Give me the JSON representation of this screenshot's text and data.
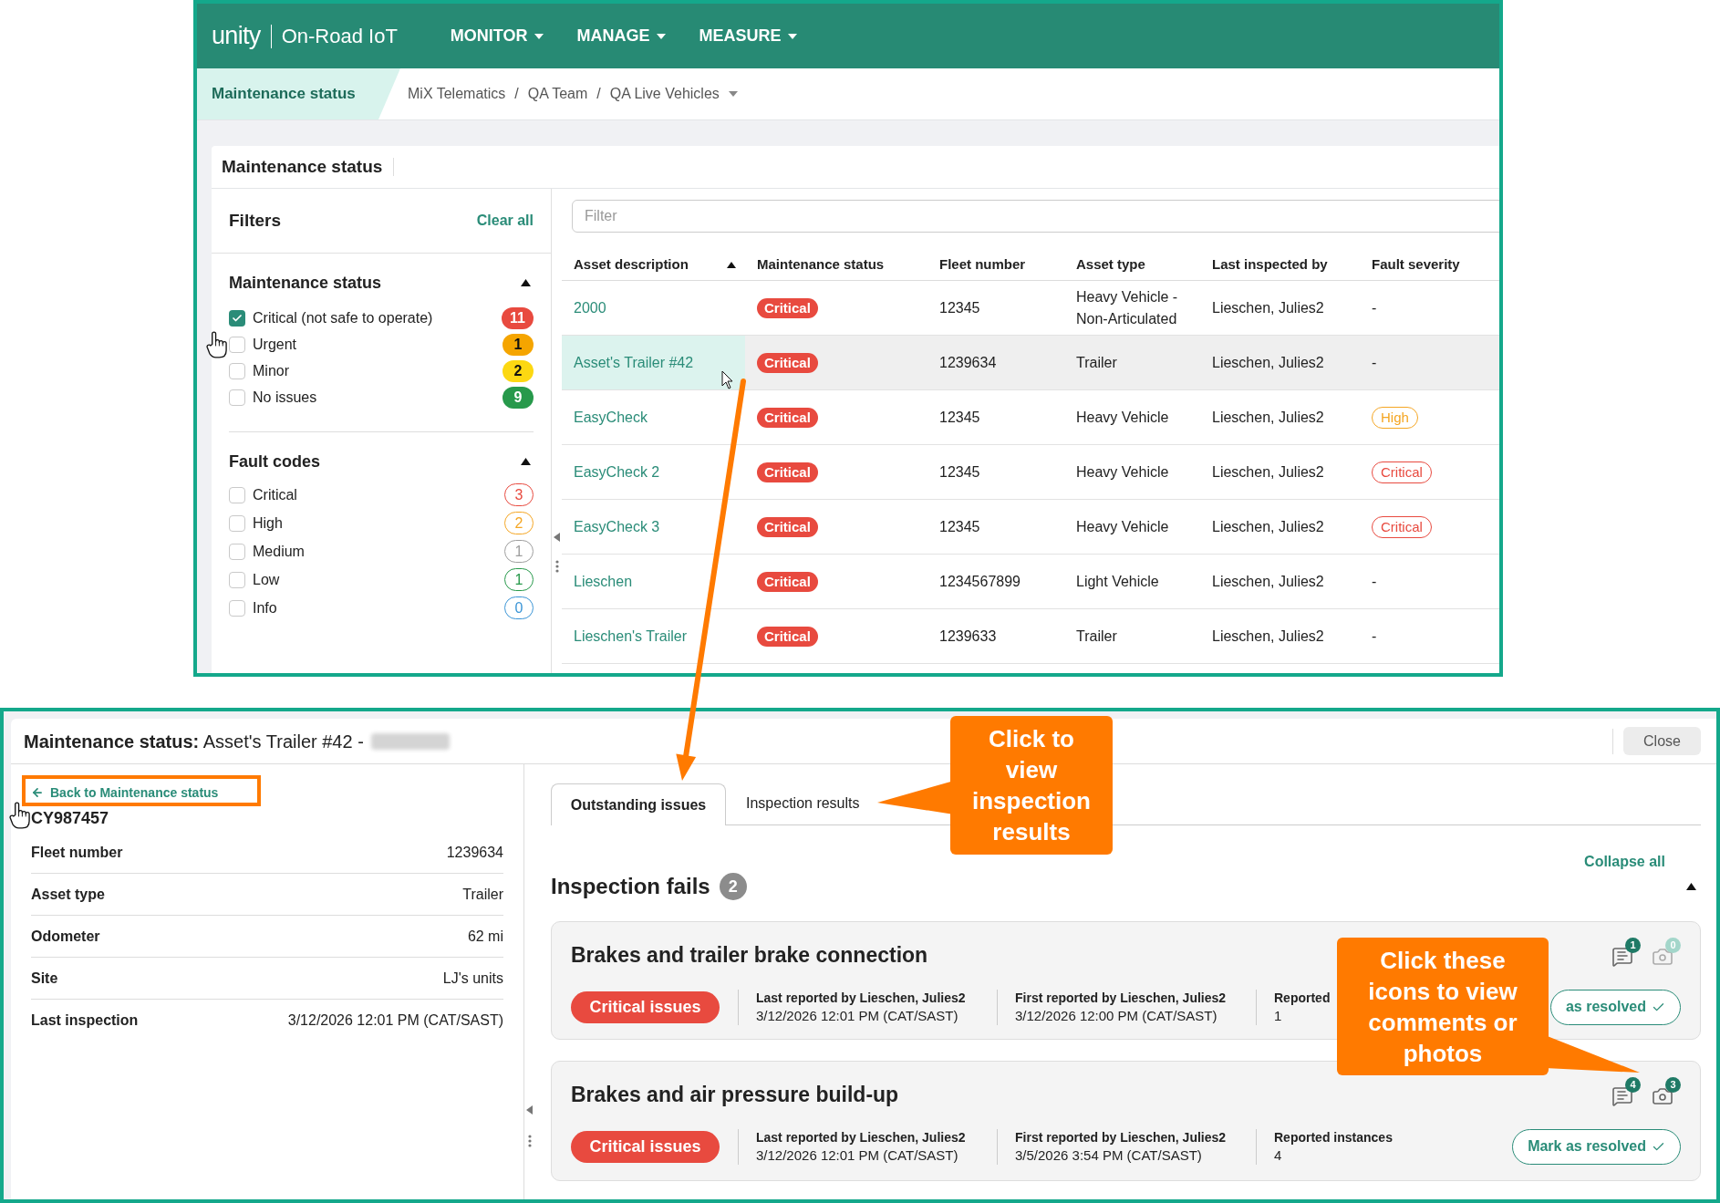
{
  "top_screenshot": {
    "brand": {
      "logo": "unity",
      "product": "On-Road IoT"
    },
    "nav_menu": [
      {
        "label": "MONITOR"
      },
      {
        "label": "MANAGE"
      },
      {
        "label": "MEASURE"
      }
    ],
    "breadcrumb": {
      "page": "Maintenance status",
      "path": [
        {
          "kind": "crumb",
          "label": "MiX Telematics"
        },
        {
          "kind": "separator",
          "label": "/"
        },
        {
          "kind": "crumb",
          "label": "QA Team"
        },
        {
          "kind": "separator",
          "label": "/"
        },
        {
          "kind": "dropdown",
          "label": "QA Live Vehicles"
        }
      ]
    },
    "card_title": "Maintenance status",
    "filters": {
      "title": "Filters",
      "clear_all": "Clear all",
      "sections": [
        {
          "title": "Maintenance status",
          "expanded": true,
          "options": [
            {
              "kind": "solid",
              "label": "Critical (not safe to operate)",
              "checked": true,
              "count": "11",
              "color": "#e84a3f"
            },
            {
              "kind": "solid",
              "label": "Urgent",
              "checked": false,
              "count": "1",
              "color": "#f5a500"
            },
            {
              "kind": "solid",
              "label": "Minor",
              "checked": false,
              "count": "2",
              "color": "#fcd812"
            },
            {
              "kind": "solid",
              "label": "No issues",
              "checked": false,
              "count": "9",
              "color": "#27994b"
            }
          ]
        },
        {
          "title": "Fault codes",
          "expanded": true,
          "options": [
            {
              "kind": "outline",
              "label": "Critical",
              "checked": false,
              "count": "3",
              "color": "#e84a3f"
            },
            {
              "kind": "outline",
              "label": "High",
              "checked": false,
              "count": "2",
              "color": "#f5a623"
            },
            {
              "kind": "outline",
              "label": "Medium",
              "checked": false,
              "count": "1",
              "color": "#9e9e9e"
            },
            {
              "kind": "outline",
              "label": "Low",
              "checked": false,
              "count": "1",
              "color": "#27994b"
            },
            {
              "kind": "outline",
              "label": "Info",
              "checked": false,
              "count": "0",
              "color": "#3b95d6"
            }
          ]
        }
      ]
    },
    "table": {
      "filter_placeholder": "Filter",
      "columns": [
        {
          "label": "Asset description",
          "sorted": true
        },
        {
          "label": "Maintenance status",
          "sorted": false
        },
        {
          "label": "Fleet number",
          "sorted": false
        },
        {
          "label": "Asset type",
          "sorted": false
        },
        {
          "label": "Last inspected by",
          "sorted": false
        },
        {
          "label": "Fault severity",
          "sorted": false
        }
      ],
      "rows": [
        {
          "highlighted": false,
          "asset": "2000",
          "status": "Critical",
          "fleet_number": "12345",
          "asset_type": "Heavy Vehicle - Non-Articulated",
          "inspected_by": "Lieschen, Julies2",
          "severity": {
            "kind": "text",
            "label": "-"
          }
        },
        {
          "highlighted": true,
          "asset": "Asset's Trailer #42",
          "status": "Critical",
          "fleet_number": "1239634",
          "asset_type": "Trailer",
          "inspected_by": "Lieschen, Julies2",
          "severity": {
            "kind": "text",
            "label": "-"
          }
        },
        {
          "highlighted": false,
          "asset": "EasyCheck",
          "status": "Critical",
          "fleet_number": "12345",
          "asset_type": "Heavy Vehicle",
          "inspected_by": "Lieschen, Julies2",
          "severity": {
            "kind": "badge",
            "label": "High",
            "color": "#f5a623"
          }
        },
        {
          "highlighted": false,
          "asset": "EasyCheck 2",
          "status": "Critical",
          "fleet_number": "12345",
          "asset_type": "Heavy Vehicle",
          "inspected_by": "Lieschen, Julies2",
          "severity": {
            "kind": "badge",
            "label": "Critical",
            "color": "#e84a3f"
          }
        },
        {
          "highlighted": false,
          "asset": "EasyCheck 3",
          "status": "Critical",
          "fleet_number": "12345",
          "asset_type": "Heavy Vehicle",
          "inspected_by": "Lieschen, Julies2",
          "severity": {
            "kind": "badge",
            "label": "Critical",
            "color": "#e84a3f"
          }
        },
        {
          "highlighted": false,
          "asset": "Lieschen",
          "status": "Critical",
          "fleet_number": "1234567899",
          "asset_type": "Light Vehicle",
          "inspected_by": "Lieschen, Julies2",
          "severity": {
            "kind": "text",
            "label": "-"
          }
        },
        {
          "highlighted": false,
          "asset": "Lieschen's Trailer",
          "status": "Critical",
          "fleet_number": "1239633",
          "asset_type": "Trailer",
          "inspected_by": "Lieschen, Julies2",
          "severity": {
            "kind": "text",
            "label": "-"
          }
        }
      ]
    }
  },
  "detail_screenshot": {
    "title": "**Maintenance status:** Asset's Trailer #42 -",
    "close_label": "Close",
    "back_link": "Back to Maintenance status",
    "asset_code": "CY987457",
    "properties": [
      {
        "label": "Fleet number",
        "value": "1239634"
      },
      {
        "label": "Asset type",
        "value": "Trailer"
      },
      {
        "label": "Odometer",
        "value": "62 mi"
      },
      {
        "label": "Site",
        "value": "LJ's units"
      },
      {
        "label": "Last inspection",
        "value": "3/12/2026 12:01 PM (CAT/SAST)"
      }
    ],
    "tabs": [
      {
        "label": "Outstanding issues",
        "selected": true
      },
      {
        "label": "Inspection results",
        "selected": false
      }
    ],
    "collapse_all": "Collapse all",
    "section": {
      "title": "Inspection fails",
      "count": "2",
      "expanded": true
    },
    "issues": [
      {
        "title": "Brakes and trailer brake connection",
        "severity": "Critical issues",
        "comments": {
          "count": "1",
          "active": true
        },
        "photos": {
          "count": "0",
          "active": false
        },
        "details": [
          {
            "label": "Last reported by Lieschen, Julies2",
            "value": "3/12/2026 12:01 PM (CAT/SAST)"
          },
          {
            "label": "First reported by Lieschen, Julies2",
            "value": "3/12/2026 12:00 PM (CAT/SAST)"
          },
          {
            "label": "Reported",
            "value": "1"
          }
        ],
        "action": "as resolved"
      },
      {
        "title": "Brakes and air pressure build-up",
        "severity": "Critical issues",
        "comments": {
          "count": "4",
          "active": true
        },
        "photos": {
          "count": "3",
          "active": true
        },
        "details": [
          {
            "label": "Last reported by Lieschen, Julies2",
            "value": "3/12/2026 12:01 PM (CAT/SAST)"
          },
          {
            "label": "First reported by Lieschen, Julies2",
            "value": "3/5/2026 3:54 PM (CAT/SAST)"
          },
          {
            "label": "Reported instances",
            "value": "4"
          }
        ],
        "action": "Mark as resolved"
      }
    ]
  },
  "annotations": [
    {
      "text": "Click to view inspection results"
    },
    {
      "text": "Click these icons to view comments or photos"
    }
  ]
}
